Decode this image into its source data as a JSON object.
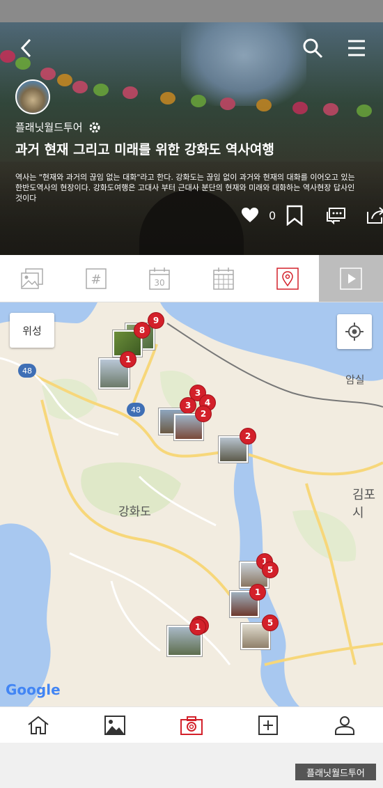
{
  "header": {
    "author": "플래닛월드투어",
    "title": "과거 현재 그리고 미래를 위한 강화도 역사여행",
    "description": "역사는 \"현재와 과거의 끊임 없는 대화\"라고 한다. 강화도는 끊임 없이 과거와 현재의 대화를 이어오고 있는 한반도역사의 현장이다. 강화도여행은 고대사 부터 근대사 분단의 현재와 미래와 대화하는 역사현장 답사인 것이다",
    "like_count": "0"
  },
  "tabs": [
    {
      "name": "photos-tab",
      "icon": "photo-stack-icon"
    },
    {
      "name": "hashtag-tab",
      "icon": "hashtag-icon"
    },
    {
      "name": "day-tab",
      "icon": "calendar-day-icon",
      "label": "30"
    },
    {
      "name": "calendar-tab",
      "icon": "calendar-grid-icon"
    },
    {
      "name": "map-tab",
      "icon": "map-pin-icon",
      "active": true
    },
    {
      "name": "video-tab",
      "icon": "play-icon"
    }
  ],
  "map": {
    "satellite_label": "위성",
    "labels": {
      "ganghwa": "강화도",
      "amsil": "암실",
      "gimpo": "김포시"
    },
    "road_shields": [
      "48",
      "48"
    ],
    "markers": [
      "9",
      "8",
      "1",
      "3",
      "3",
      "4",
      "2",
      "2",
      "1",
      "5",
      "1",
      "5",
      "1"
    ],
    "attribution": "Google"
  },
  "bottom_nav": [
    {
      "name": "home-nav",
      "icon": "home-icon"
    },
    {
      "name": "gallery-nav",
      "icon": "image-icon"
    },
    {
      "name": "camera-nav",
      "icon": "camera-icon"
    },
    {
      "name": "add-nav",
      "icon": "plus-box-icon"
    },
    {
      "name": "profile-nav",
      "icon": "user-icon"
    }
  ],
  "footer_tag": "플래닛월드투어",
  "colors": {
    "accent": "#d3202a",
    "water": "#a8c8f0",
    "land": "#f2ece0",
    "road_yellow": "#f7d77a"
  }
}
